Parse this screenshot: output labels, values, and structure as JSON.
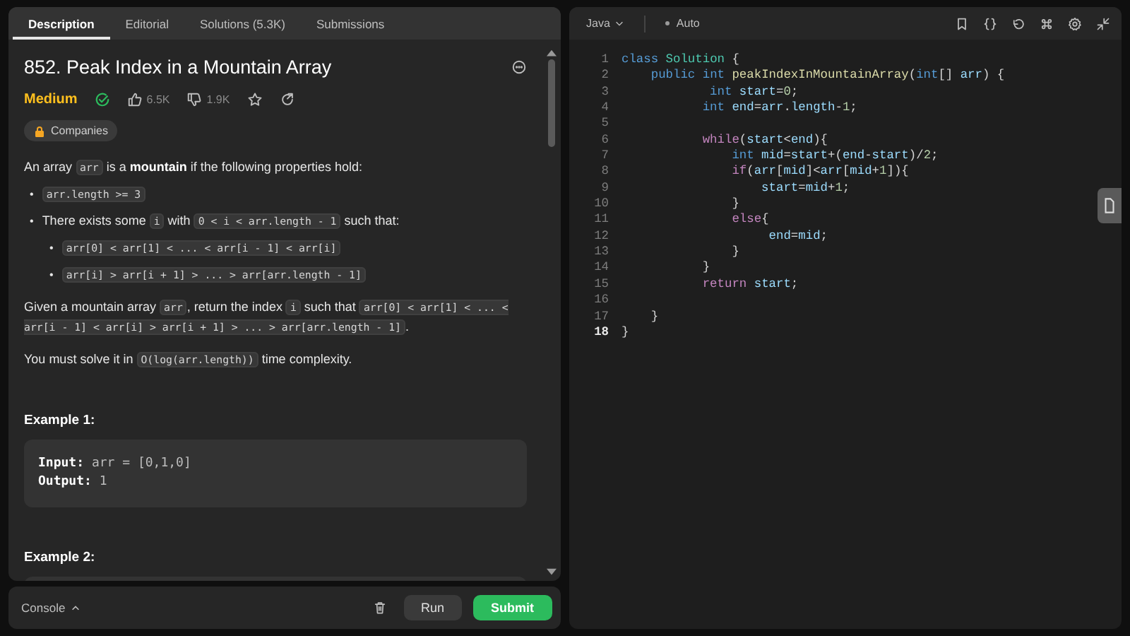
{
  "problem_tabs": [
    {
      "label": "Description",
      "selected": true
    },
    {
      "label": "Editorial",
      "selected": false
    },
    {
      "label": "Solutions (5.3K)",
      "selected": false
    },
    {
      "label": "Submissions",
      "selected": false
    }
  ],
  "problem": {
    "title": "852. Peak Index in a Mountain Array",
    "difficulty": "Medium",
    "solved": true,
    "likes": "6.5K",
    "dislikes": "1.9K",
    "companies_label": "Companies"
  },
  "description": [
    {
      "kind": "para",
      "segments": [
        {
          "kind": "text",
          "text": "An array "
        },
        {
          "kind": "code",
          "text": "arr"
        },
        {
          "kind": "text",
          "text": " is a "
        },
        {
          "kind": "bold",
          "text": "mountain"
        },
        {
          "kind": "text",
          "text": " if the following properties hold:"
        }
      ]
    },
    {
      "kind": "bullets",
      "items": [
        {
          "marker": "•",
          "segments": [
            {
              "kind": "code",
              "text": "arr.length >= 3"
            }
          ]
        },
        {
          "marker": "•",
          "segments": [
            {
              "kind": "text",
              "text": "There exists some "
            },
            {
              "kind": "code",
              "text": "i"
            },
            {
              "kind": "text",
              "text": " with "
            },
            {
              "kind": "code",
              "text": "0 < i < arr.length - 1"
            },
            {
              "kind": "text",
              "text": " such that:"
            }
          ],
          "children": [
            {
              "marker": "•",
              "segments": [
                {
                  "kind": "code",
                  "text": "arr[0] < arr[1] < ... < arr[i - 1] < arr[i]"
                }
              ]
            },
            {
              "marker": "•",
              "segments": [
                {
                  "kind": "code",
                  "text": "arr[i] > arr[i + 1] > ... > arr[arr.length - 1]"
                }
              ]
            }
          ]
        }
      ]
    },
    {
      "kind": "para",
      "segments": [
        {
          "kind": "text",
          "text": "Given a mountain array "
        },
        {
          "kind": "code",
          "text": "arr"
        },
        {
          "kind": "text",
          "text": ", return the index "
        },
        {
          "kind": "code",
          "text": "i"
        },
        {
          "kind": "text",
          "text": " such that "
        },
        {
          "kind": "code",
          "text": "arr[0] < arr[1] < ... < arr[i - 1] < arr[i] > arr[i + 1] > ... > arr[arr.length - 1]"
        },
        {
          "kind": "text",
          "text": "."
        }
      ]
    },
    {
      "kind": "para",
      "segments": [
        {
          "kind": "text",
          "text": "You must solve it in "
        },
        {
          "kind": "code",
          "text": "O(log(arr.length))"
        },
        {
          "kind": "text",
          "text": " time complexity."
        }
      ]
    },
    {
      "kind": "example",
      "heading": "Example 1:",
      "lines": [
        {
          "label": "Input:",
          "value": "arr = [0,1,0]"
        },
        {
          "label": "Output:",
          "value": "1"
        }
      ]
    },
    {
      "kind": "example",
      "heading": "Example 2:"
    }
  ],
  "editor": {
    "language": "Java",
    "mode": "Auto",
    "lines": [
      {
        "number": "1",
        "current": false,
        "tokens": [
          {
            "kind": "kw",
            "text": "class"
          },
          {
            "kind": "type",
            "text": " Solution"
          },
          {
            "kind": "p",
            "text": " {"
          }
        ]
      },
      {
        "number": "2",
        "current": false,
        "tokens": [
          {
            "kind": "kw",
            "text": "    public"
          },
          {
            "kind": "kw",
            "text": " int"
          },
          {
            "kind": "fn",
            "text": " peakIndexInMountainArray"
          },
          {
            "kind": "p",
            "text": "("
          },
          {
            "kind": "kw",
            "text": "int"
          },
          {
            "kind": "p",
            "text": "[] "
          },
          {
            "kind": "var",
            "text": "arr"
          },
          {
            "kind": "p",
            "text": ") {"
          }
        ]
      },
      {
        "number": "3",
        "current": false,
        "tokens": [
          {
            "kind": "kw",
            "text": "            int"
          },
          {
            "kind": "var",
            "text": " start"
          },
          {
            "kind": "p",
            "text": "="
          },
          {
            "kind": "num",
            "text": "0"
          },
          {
            "kind": "p",
            "text": ";"
          }
        ]
      },
      {
        "number": "4",
        "current": false,
        "tokens": [
          {
            "kind": "kw",
            "text": "           int"
          },
          {
            "kind": "var",
            "text": " end"
          },
          {
            "kind": "p",
            "text": "="
          },
          {
            "kind": "var",
            "text": "arr"
          },
          {
            "kind": "p",
            "text": "."
          },
          {
            "kind": "var",
            "text": "length"
          },
          {
            "kind": "p",
            "text": "-"
          },
          {
            "kind": "num",
            "text": "1"
          },
          {
            "kind": "p",
            "text": ";"
          }
        ]
      },
      {
        "number": "5",
        "current": false
      },
      {
        "number": "6",
        "current": false,
        "tokens": [
          {
            "kind": "ctl",
            "text": "           while"
          },
          {
            "kind": "p",
            "text": "("
          },
          {
            "kind": "var",
            "text": "start"
          },
          {
            "kind": "p",
            "text": "<"
          },
          {
            "kind": "var",
            "text": "end"
          },
          {
            "kind": "p",
            "text": "){"
          }
        ]
      },
      {
        "number": "7",
        "current": false,
        "tokens": [
          {
            "kind": "kw",
            "text": "               int"
          },
          {
            "kind": "var",
            "text": " mid"
          },
          {
            "kind": "p",
            "text": "="
          },
          {
            "kind": "var",
            "text": "start"
          },
          {
            "kind": "p",
            "text": "+("
          },
          {
            "kind": "var",
            "text": "end"
          },
          {
            "kind": "p",
            "text": "-"
          },
          {
            "kind": "var",
            "text": "start"
          },
          {
            "kind": "p",
            "text": ")/"
          },
          {
            "kind": "num",
            "text": "2"
          },
          {
            "kind": "p",
            "text": ";"
          }
        ]
      },
      {
        "number": "8",
        "current": false,
        "tokens": [
          {
            "kind": "ctl",
            "text": "               if"
          },
          {
            "kind": "p",
            "text": "("
          },
          {
            "kind": "var",
            "text": "arr"
          },
          {
            "kind": "p",
            "text": "["
          },
          {
            "kind": "var",
            "text": "mid"
          },
          {
            "kind": "p",
            "text": "]<"
          },
          {
            "kind": "var",
            "text": "arr"
          },
          {
            "kind": "p",
            "text": "["
          },
          {
            "kind": "var",
            "text": "mid"
          },
          {
            "kind": "p",
            "text": "+"
          },
          {
            "kind": "num",
            "text": "1"
          },
          {
            "kind": "p",
            "text": "]){"
          }
        ]
      },
      {
        "number": "9",
        "current": false,
        "tokens": [
          {
            "kind": "var",
            "text": "                   start"
          },
          {
            "kind": "p",
            "text": "="
          },
          {
            "kind": "var",
            "text": "mid"
          },
          {
            "kind": "p",
            "text": "+"
          },
          {
            "kind": "num",
            "text": "1"
          },
          {
            "kind": "p",
            "text": ";"
          }
        ]
      },
      {
        "number": "10",
        "current": false,
        "tokens": [
          {
            "kind": "p",
            "text": "               }"
          }
        ]
      },
      {
        "number": "11",
        "current": false,
        "tokens": [
          {
            "kind": "ctl",
            "text": "               else"
          },
          {
            "kind": "p",
            "text": "{"
          }
        ]
      },
      {
        "number": "12",
        "current": false,
        "tokens": [
          {
            "kind": "var",
            "text": "                    end"
          },
          {
            "kind": "p",
            "text": "="
          },
          {
            "kind": "var",
            "text": "mid"
          },
          {
            "kind": "p",
            "text": ";"
          }
        ]
      },
      {
        "number": "13",
        "current": false,
        "tokens": [
          {
            "kind": "p",
            "text": "               }"
          }
        ]
      },
      {
        "number": "14",
        "current": false,
        "tokens": [
          {
            "kind": "p",
            "text": "           }"
          }
        ]
      },
      {
        "number": "15",
        "current": false,
        "tokens": [
          {
            "kind": "ctl",
            "text": "           return"
          },
          {
            "kind": "var",
            "text": " start"
          },
          {
            "kind": "p",
            "text": ";"
          }
        ]
      },
      {
        "number": "16",
        "current": false
      },
      {
        "number": "17",
        "current": false,
        "tokens": [
          {
            "kind": "p",
            "text": "    }"
          }
        ]
      },
      {
        "number": "18",
        "current": true,
        "tokens": [
          {
            "kind": "p",
            "text": "}"
          }
        ]
      }
    ]
  },
  "console": {
    "label": "Console",
    "run_label": "Run",
    "submit_label": "Submit"
  }
}
